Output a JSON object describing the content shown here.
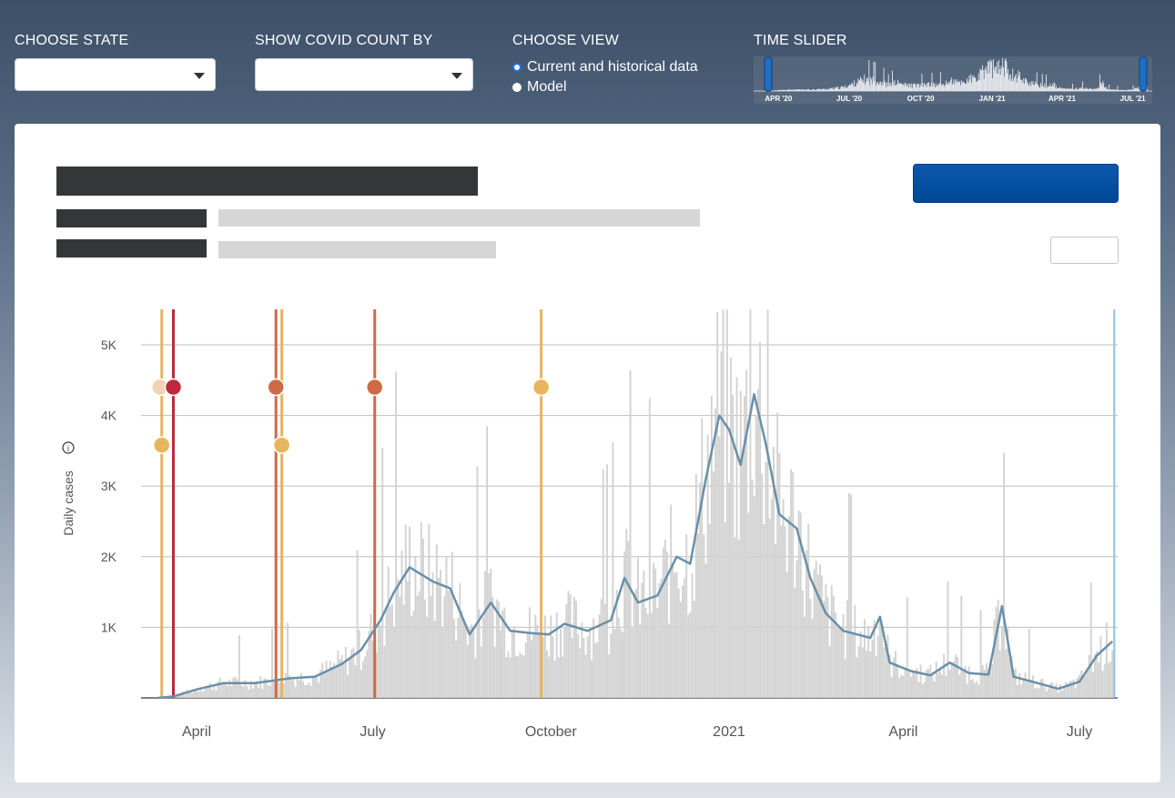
{
  "controls": {
    "state_label": "CHOOSE STATE",
    "state_value": "",
    "count_label": "SHOW COVID COUNT BY",
    "count_value": "",
    "view_label": "CHOOSE VIEW",
    "view_options": [
      {
        "label": "Current and historical data",
        "selected": true
      },
      {
        "label": "Model",
        "selected": false
      }
    ],
    "slider_label": "TIME SLIDER",
    "slider_ticks": [
      "APR '20",
      "JUL '20",
      "OCT '20",
      "JAN '21",
      "APR '21",
      "JUL '21"
    ]
  },
  "panel": {
    "title": "",
    "button_label": "",
    "info_icon": "info-icon"
  },
  "colors": {
    "bar": "#d2d2d2",
    "line": "#6b8fa8",
    "event_yellow": "#e8b55c",
    "event_red": "#c0283a",
    "event_orange": "#cf6a45",
    "event_pale": "#efd3b3",
    "end_marker": "#8cc0ea",
    "accent_button": "#004a98"
  },
  "chart_data": {
    "type": "bar",
    "ylabel": "Daily cases",
    "ylim": [
      0,
      5500
    ],
    "yticks": [
      {
        "v": 1000,
        "label": "1K"
      },
      {
        "v": 2000,
        "label": "2K"
      },
      {
        "v": 3000,
        "label": "3K"
      },
      {
        "v": 4000,
        "label": "4K"
      },
      {
        "v": 5000,
        "label": "5K"
      }
    ],
    "xlim": [
      "2020-03-01",
      "2021-07-31"
    ],
    "xticks": [
      {
        "date": "2020-04-01",
        "label": "April"
      },
      {
        "date": "2020-07-01",
        "label": "July"
      },
      {
        "date": "2020-10-01",
        "label": "October"
      },
      {
        "date": "2021-01-01",
        "label": "2021"
      },
      {
        "date": "2021-04-01",
        "label": "April"
      },
      {
        "date": "2021-07-01",
        "label": "July"
      }
    ],
    "grid": true,
    "series": [
      {
        "name": "",
        "kind": "7-day average line",
        "points": [
          [
            "2020-03-12",
            0
          ],
          [
            "2020-03-20",
            20
          ],
          [
            "2020-04-01",
            120
          ],
          [
            "2020-04-15",
            210
          ],
          [
            "2020-05-01",
            210
          ],
          [
            "2020-05-20",
            280
          ],
          [
            "2020-06-01",
            300
          ],
          [
            "2020-06-15",
            480
          ],
          [
            "2020-06-25",
            680
          ],
          [
            "2020-07-05",
            1100
          ],
          [
            "2020-07-12",
            1500
          ],
          [
            "2020-07-20",
            1850
          ],
          [
            "2020-08-01",
            1650
          ],
          [
            "2020-08-10",
            1550
          ],
          [
            "2020-08-20",
            900
          ],
          [
            "2020-08-31",
            1350
          ],
          [
            "2020-09-10",
            950
          ],
          [
            "2020-09-20",
            920
          ],
          [
            "2020-09-30",
            900
          ],
          [
            "2020-10-08",
            1050
          ],
          [
            "2020-10-20",
            950
          ],
          [
            "2020-11-01",
            1100
          ],
          [
            "2020-11-08",
            1700
          ],
          [
            "2020-11-15",
            1350
          ],
          [
            "2020-11-25",
            1450
          ],
          [
            "2020-12-05",
            2000
          ],
          [
            "2020-12-12",
            1900
          ],
          [
            "2020-12-20",
            3100
          ],
          [
            "2020-12-27",
            4000
          ],
          [
            "2021-01-01",
            3800
          ],
          [
            "2021-01-07",
            3300
          ],
          [
            "2021-01-14",
            4300
          ],
          [
            "2021-01-20",
            3600
          ],
          [
            "2021-01-27",
            2600
          ],
          [
            "2021-02-05",
            2400
          ],
          [
            "2021-02-12",
            1700
          ],
          [
            "2021-02-20",
            1200
          ],
          [
            "2021-03-01",
            950
          ],
          [
            "2021-03-15",
            850
          ],
          [
            "2021-03-20",
            1150
          ],
          [
            "2021-03-25",
            500
          ],
          [
            "2021-04-05",
            380
          ],
          [
            "2021-04-15",
            320
          ],
          [
            "2021-04-25",
            500
          ],
          [
            "2021-05-05",
            350
          ],
          [
            "2021-05-15",
            330
          ],
          [
            "2021-05-22",
            1300
          ],
          [
            "2021-05-28",
            300
          ],
          [
            "2021-06-08",
            220
          ],
          [
            "2021-06-20",
            130
          ],
          [
            "2021-07-01",
            230
          ],
          [
            "2021-07-10",
            600
          ],
          [
            "2021-07-18",
            800
          ]
        ]
      }
    ],
    "events": [
      {
        "date": "2020-03-14",
        "color": "#e8b55c",
        "dot_value": 3580,
        "extra_dot_value": 4400,
        "extra_dot_color": "#efd3b3"
      },
      {
        "date": "2020-03-20",
        "color": "#c0283a",
        "dot_value": 4400
      },
      {
        "date": "2020-05-12",
        "color": "#cf6a45",
        "dot_value": 4400
      },
      {
        "date": "2020-05-15",
        "color": "#e8b55c",
        "dot_value": 3580
      },
      {
        "date": "2020-07-02",
        "color": "#cf6a45",
        "dot_value": 4400
      },
      {
        "date": "2020-09-26",
        "color": "#e8b55c",
        "dot_value": 4400
      }
    ],
    "end_marker": "2021-07-19"
  }
}
